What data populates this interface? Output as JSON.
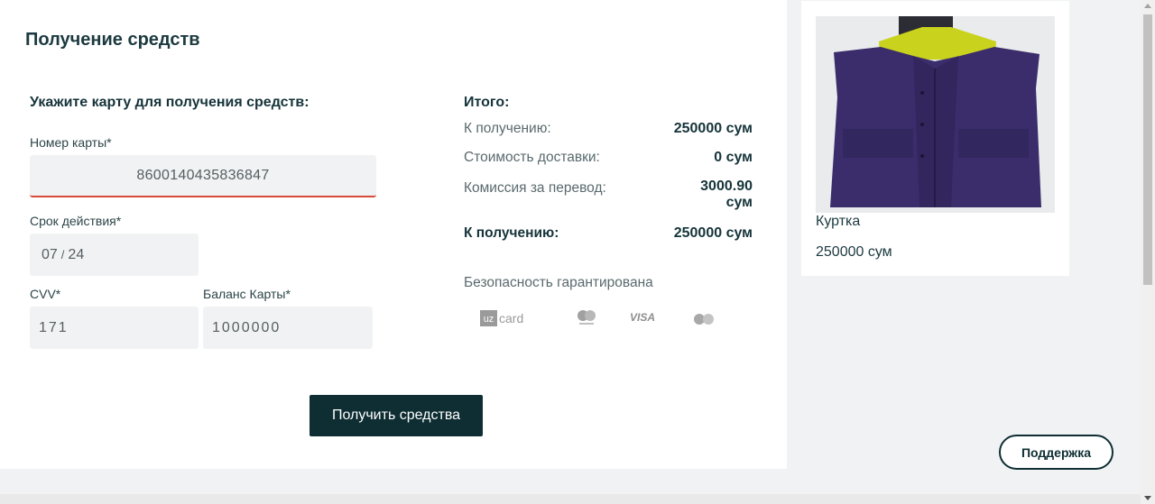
{
  "page": {
    "title": "Получение средств"
  },
  "form": {
    "heading": "Укажите карту для получения средств:",
    "card_number": {
      "label": "Номер карты*",
      "value": "8600140435836847"
    },
    "expiry": {
      "label": "Срок действия*",
      "month": "07",
      "separator": "/",
      "year": "24"
    },
    "cvv": {
      "label": "CVV*",
      "value": "171"
    },
    "balance": {
      "label": "Баланс Карты*",
      "value": "1000000"
    },
    "submit_label": "Получить средства"
  },
  "summary": {
    "heading": "Итого:",
    "rows": [
      {
        "label": "К получению:",
        "value": "250000 сум"
      },
      {
        "label": "Стоимость доставки:",
        "value": "0 сум"
      },
      {
        "label": "Комиссия за перевод:",
        "value_line1": "3000.90",
        "value_line2": "сум"
      }
    ],
    "total": {
      "label": "К получению:",
      "value": "250000 сум"
    },
    "security_text": "Безопасность гарантирована",
    "payment_logos": {
      "uzcard_prefix": "uz",
      "uzcard_suffix": "card",
      "visa": "VISA"
    }
  },
  "product": {
    "name": "Куртка",
    "price": "250000 сум",
    "image_icon": "vest-jacket-photo"
  },
  "support_label": "Поддержка",
  "colors": {
    "primary": "#0e2e33",
    "error_underline": "#d64b3a",
    "field_bg": "#f1f2f3",
    "page_bg": "#f1f2f4"
  }
}
